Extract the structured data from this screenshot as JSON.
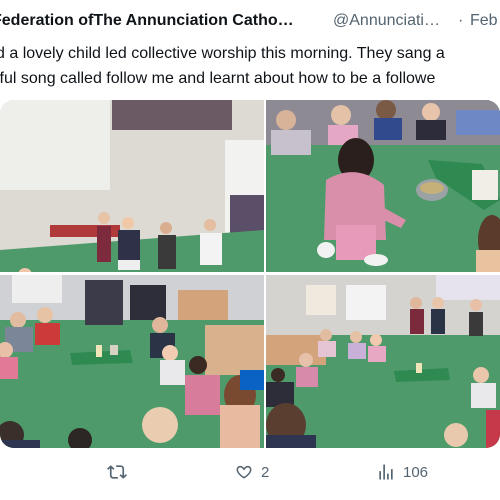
{
  "tweet": {
    "author_name": "Federation ofThe Annunciation Catho…",
    "handle": "@Annunciati…",
    "separator": "·",
    "date": "Feb",
    "text_lines": [
      "d a lovely child led collective worship this morning. They sang a",
      "iful song called follow me and learnt about how to be a followe"
    ]
  },
  "media": {
    "photos": [
      {
        "name": "photo-1",
        "subject": "children standing at front of classroom singing"
      },
      {
        "name": "photo-2",
        "subject": "child kneeling on carpet placing items in bowl"
      },
      {
        "name": "photo-3",
        "subject": "children seated in circle around worship cloth"
      },
      {
        "name": "photo-4",
        "subject": "children seated in circle around worship cloth wide view"
      }
    ]
  },
  "actions": {
    "retweet_icon": "retweet-icon",
    "retweet_count": "",
    "like_icon": "heart-icon",
    "like_count": "2",
    "views_icon": "views-chart-icon",
    "views_count": "106"
  },
  "colors": {
    "text": "#0f1419",
    "secondary_text": "#536471",
    "carpet": "#4f9a6a"
  }
}
